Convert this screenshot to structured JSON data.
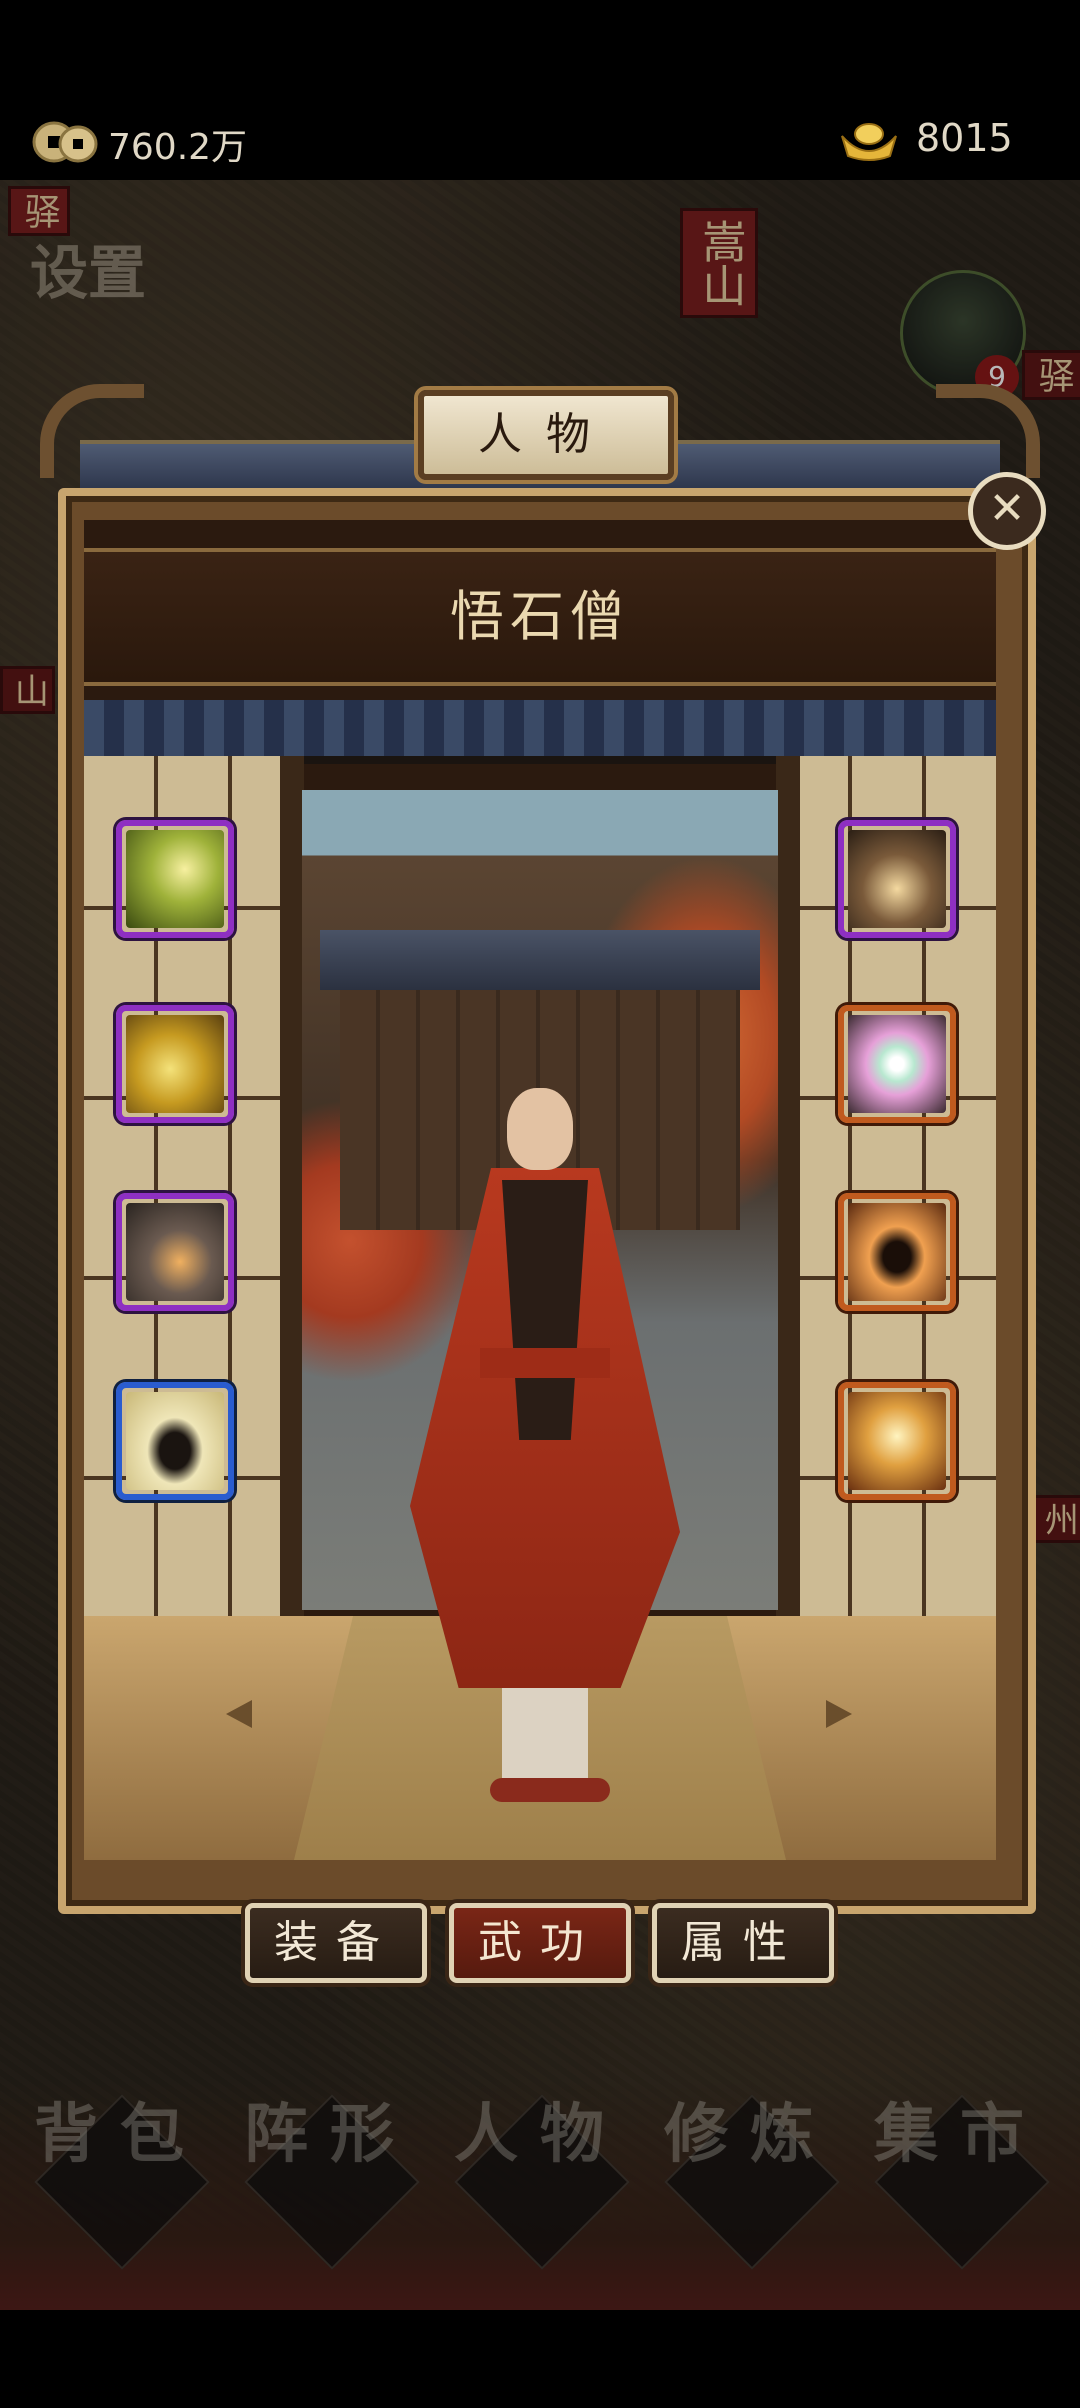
{
  "resources": {
    "coins": {
      "icon": "copper-coins-icon",
      "value": "760.2万"
    },
    "ingots": {
      "icon": "gold-ingot-icon",
      "value": "8015"
    }
  },
  "map": {
    "settings_label": "设置",
    "stations": [
      "驿",
      "驿"
    ],
    "mountain_label": "嵩山",
    "side_labels": [
      "山",
      "州"
    ],
    "npc_level": "9"
  },
  "modal": {
    "title": "人物",
    "character_name": "悟石僧",
    "close_icon": "close-icon",
    "left_skills": [
      {
        "icon": "praying-hands-skill-icon",
        "rarity": "purple"
      },
      {
        "icon": "golden-orb-skill-icon",
        "rarity": "purple"
      },
      {
        "icon": "roaring-lion-skill-icon",
        "rarity": "purple"
      },
      {
        "icon": "silhouette-skill-icon",
        "rarity": "blue"
      }
    ],
    "right_skills": [
      {
        "icon": "spinning-monk-skill-icon",
        "rarity": "purple"
      },
      {
        "icon": "yin-yang-orbs-skill-icon",
        "rarity": "orange"
      },
      {
        "icon": "fire-silhouette-skill-icon",
        "rarity": "orange"
      },
      {
        "icon": "palm-strike-skill-icon",
        "rarity": "orange"
      }
    ],
    "tabs": [
      {
        "label": "装备",
        "active": false
      },
      {
        "label": "武功",
        "active": true
      },
      {
        "label": "属性",
        "active": false
      }
    ]
  },
  "bottom_nav": [
    {
      "label": "背包"
    },
    {
      "label": "阵形"
    },
    {
      "label": "人物"
    },
    {
      "label": "修炼"
    },
    {
      "label": "集市"
    }
  ],
  "colors": {
    "purple_rarity": "#8e2fc2",
    "blue_rarity": "#2a5ccf",
    "orange_rarity": "#c05a1e",
    "active_tab": "#7a2616"
  }
}
